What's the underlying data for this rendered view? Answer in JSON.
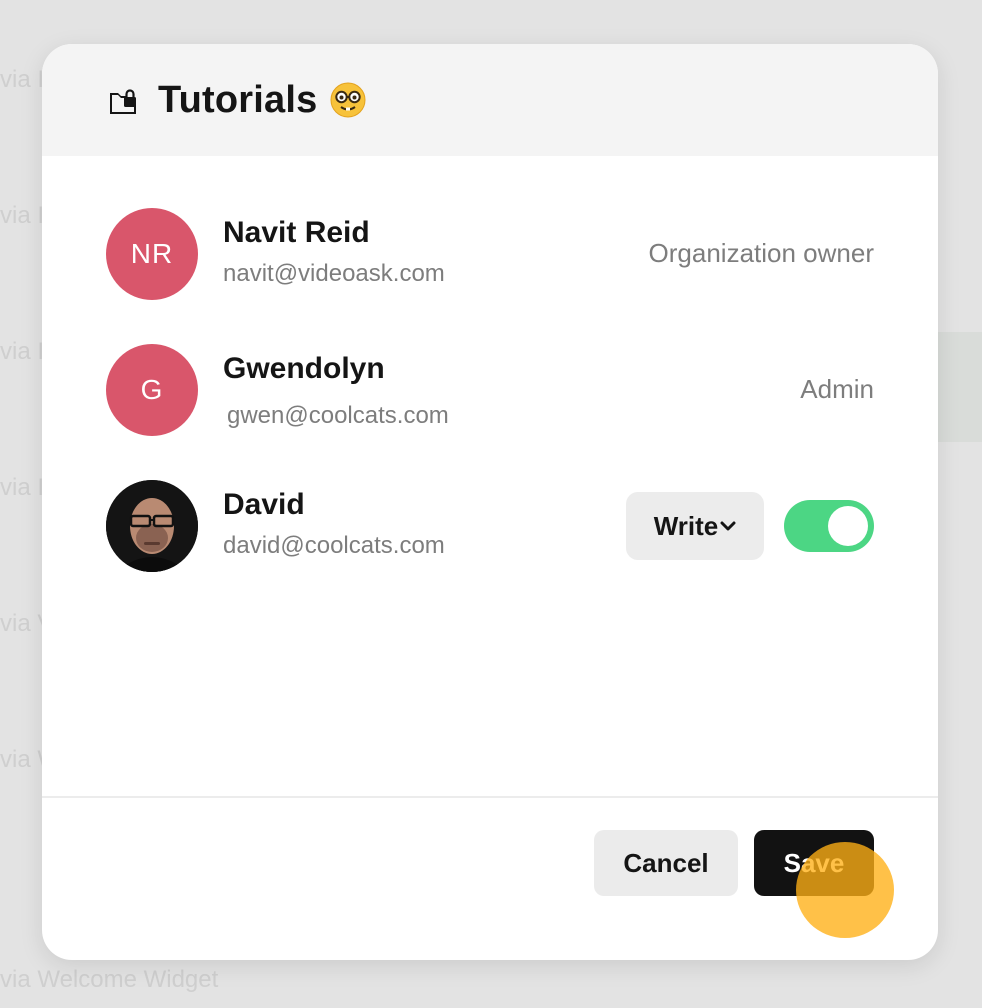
{
  "background": {
    "rows": [
      "via I",
      "via I",
      "via I",
      "via I",
      "via V",
      "via W",
      "via W",
      "via Welcome Widget"
    ]
  },
  "modal": {
    "title": "Tutorials",
    "title_icon": "shared-folder-lock-icon",
    "title_emoji": "nerd-face-emoji"
  },
  "members": [
    {
      "initials": "NR",
      "name": "Navit Reid",
      "email": "navit@videoask.com",
      "role": "Organization owner",
      "avatar_color": "#d9566b"
    },
    {
      "initials": "G",
      "name": "Gwendolyn",
      "email": "gwen@coolcats.com",
      "role": "Admin",
      "avatar_color": "#d9566b"
    },
    {
      "name": "David",
      "email": "david@coolcats.com",
      "permission": "Write",
      "access_enabled": true,
      "avatar": "user-photo"
    }
  ],
  "footer": {
    "cancel_label": "Cancel",
    "save_label": "Save"
  },
  "colors": {
    "toggle_on": "#4cd684",
    "save_button": "#121212",
    "cursor_highlight": "#ffaf14"
  }
}
